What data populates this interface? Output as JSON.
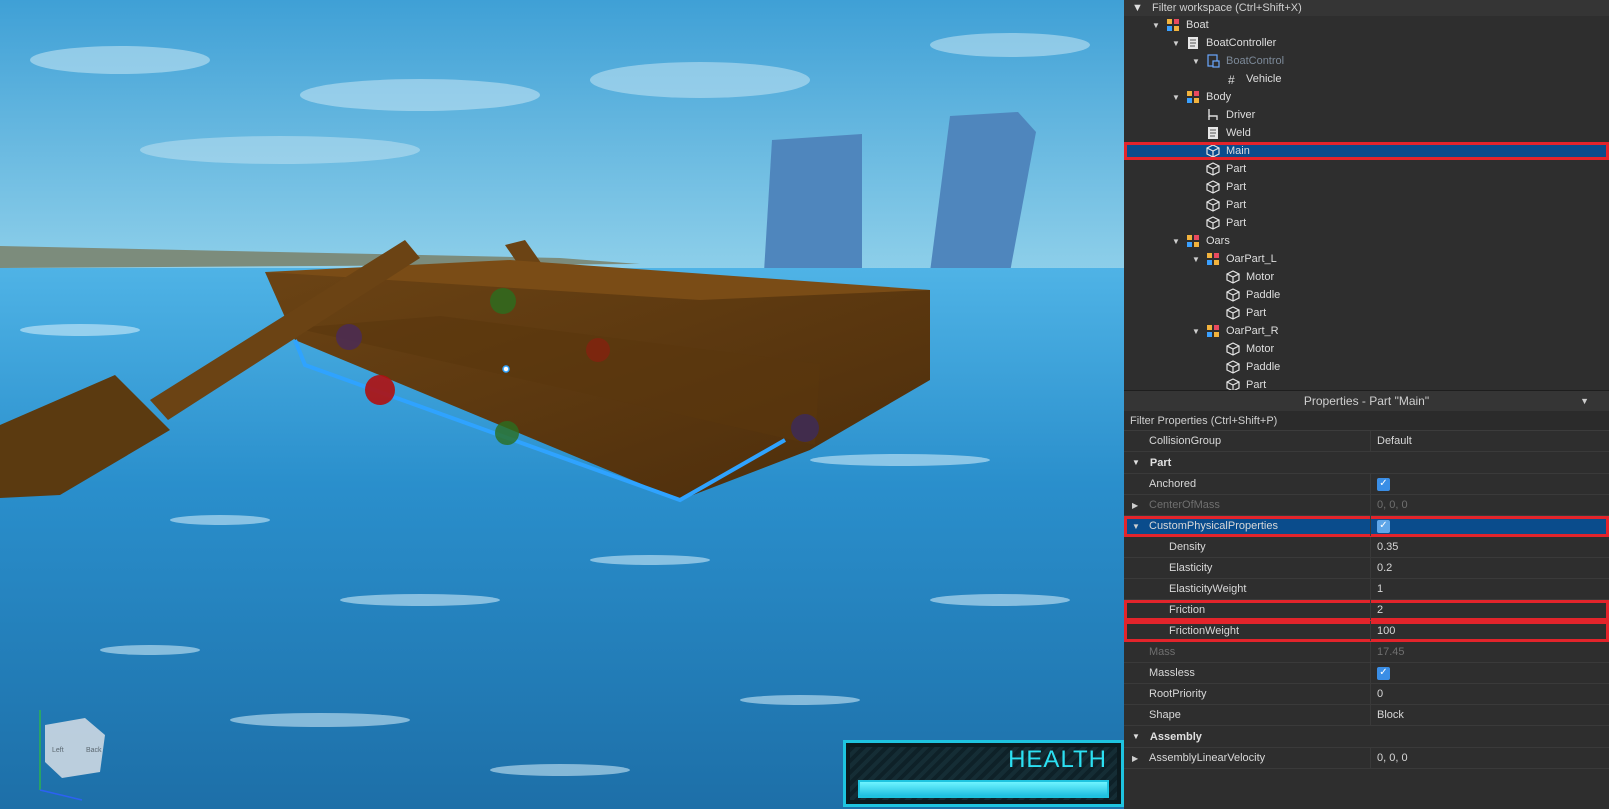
{
  "viewport": {
    "health_label": "HEALTH",
    "health_fraction": 1.0,
    "cube_faces": [
      "Left",
      "Back"
    ]
  },
  "explorer": {
    "filter_placeholder": "Filter workspace (Ctrl+Shift+X)",
    "items": [
      {
        "label": "Boat",
        "icon": "model-icon",
        "depth": 1,
        "expanded": true
      },
      {
        "label": "BoatController",
        "icon": "script-icon",
        "depth": 2,
        "expanded": true
      },
      {
        "label": "BoatControl",
        "icon": "local-script-icon",
        "depth": 3,
        "expanded": true,
        "dim": true
      },
      {
        "label": "Vehicle",
        "icon": "value-icon",
        "depth": 4
      },
      {
        "label": "Body",
        "icon": "model-icon",
        "depth": 2,
        "expanded": true
      },
      {
        "label": "Driver",
        "icon": "seat-icon",
        "depth": 3
      },
      {
        "label": "Weld",
        "icon": "script-icon",
        "depth": 3
      },
      {
        "label": "Main",
        "icon": "part-icon",
        "depth": 3,
        "selected": true
      },
      {
        "label": "Part",
        "icon": "part-icon",
        "depth": 3
      },
      {
        "label": "Part",
        "icon": "part-icon",
        "depth": 3
      },
      {
        "label": "Part",
        "icon": "part-icon",
        "depth": 3
      },
      {
        "label": "Part",
        "icon": "part-icon",
        "depth": 3
      },
      {
        "label": "Oars",
        "icon": "model-icon",
        "depth": 2,
        "expanded": true
      },
      {
        "label": "OarPart_L",
        "icon": "model-icon",
        "depth": 3,
        "expanded": true
      },
      {
        "label": "Motor",
        "icon": "part-icon",
        "depth": 4
      },
      {
        "label": "Paddle",
        "icon": "part-icon",
        "depth": 4
      },
      {
        "label": "Part",
        "icon": "part-icon",
        "depth": 4
      },
      {
        "label": "OarPart_R",
        "icon": "model-icon",
        "depth": 3,
        "expanded": true
      },
      {
        "label": "Motor",
        "icon": "part-icon",
        "depth": 4
      },
      {
        "label": "Paddle",
        "icon": "part-icon",
        "depth": 4
      },
      {
        "label": "Part",
        "icon": "part-icon",
        "depth": 4
      }
    ]
  },
  "properties": {
    "title": "Properties - Part \"Main\"",
    "filter_placeholder": "Filter Properties (Ctrl+Shift+P)",
    "rows": [
      {
        "kind": "prop",
        "name": "CollisionGroup",
        "value": "Default"
      },
      {
        "kind": "section",
        "name": "Part"
      },
      {
        "kind": "prop",
        "name": "Anchored",
        "check": true
      },
      {
        "kind": "prop",
        "name": "CenterOfMass",
        "value": "0, 0, 0",
        "dim": true,
        "expander": "collapsed"
      },
      {
        "kind": "prop",
        "name": "CustomPhysicalProperties",
        "check": true,
        "expander": "expanded",
        "highlight": true
      },
      {
        "kind": "prop",
        "name": "Density",
        "value": "0.35",
        "indent": true
      },
      {
        "kind": "prop",
        "name": "Elasticity",
        "value": "0.2",
        "indent": true
      },
      {
        "kind": "prop",
        "name": "ElasticityWeight",
        "value": "1",
        "indent": true
      },
      {
        "kind": "prop",
        "name": "Friction",
        "value": "2",
        "indent": true,
        "boxed": true
      },
      {
        "kind": "prop",
        "name": "FrictionWeight",
        "value": "100",
        "indent": true,
        "boxed": true
      },
      {
        "kind": "prop",
        "name": "Mass",
        "value": "17.45",
        "dim": true
      },
      {
        "kind": "prop",
        "name": "Massless",
        "check": true
      },
      {
        "kind": "prop",
        "name": "RootPriority",
        "value": "0"
      },
      {
        "kind": "prop",
        "name": "Shape",
        "value": "Block"
      },
      {
        "kind": "section",
        "name": "Assembly"
      },
      {
        "kind": "prop",
        "name": "AssemblyLinearVelocity",
        "value": "0, 0, 0",
        "expander": "collapsed"
      }
    ]
  },
  "colors": {
    "selection": "#0a4c8c",
    "highlight_border": "#e3242b",
    "checkbox": "#3a8ee6",
    "health": "#1ec4e0"
  }
}
